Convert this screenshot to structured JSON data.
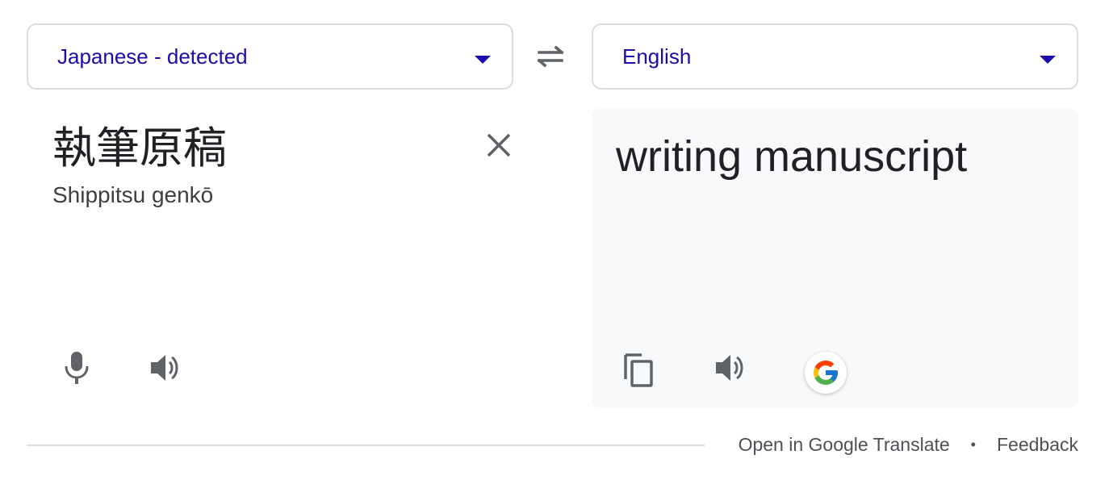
{
  "source_language": {
    "label": "Japanese - detected"
  },
  "target_language": {
    "label": "English"
  },
  "icons": {
    "swap": "swap-arrows-icon",
    "clear": "close-icon",
    "mic": "microphone-icon",
    "speaker": "speaker-icon",
    "copy": "copy-icon",
    "google": "google-logo-icon",
    "dropdown": "chevron-down-icon"
  },
  "source": {
    "text": "執筆原稿",
    "romanization": "Shippitsu genkō"
  },
  "target": {
    "text": "writing manuscript"
  },
  "footer": {
    "open_link": "Open in Google Translate",
    "separator": "•",
    "feedback_link": "Feedback"
  },
  "colors": {
    "language_label": "#1a0dab",
    "icon": "#5f6368",
    "target_background": "#f8f9fa",
    "border": "#dadce0"
  }
}
